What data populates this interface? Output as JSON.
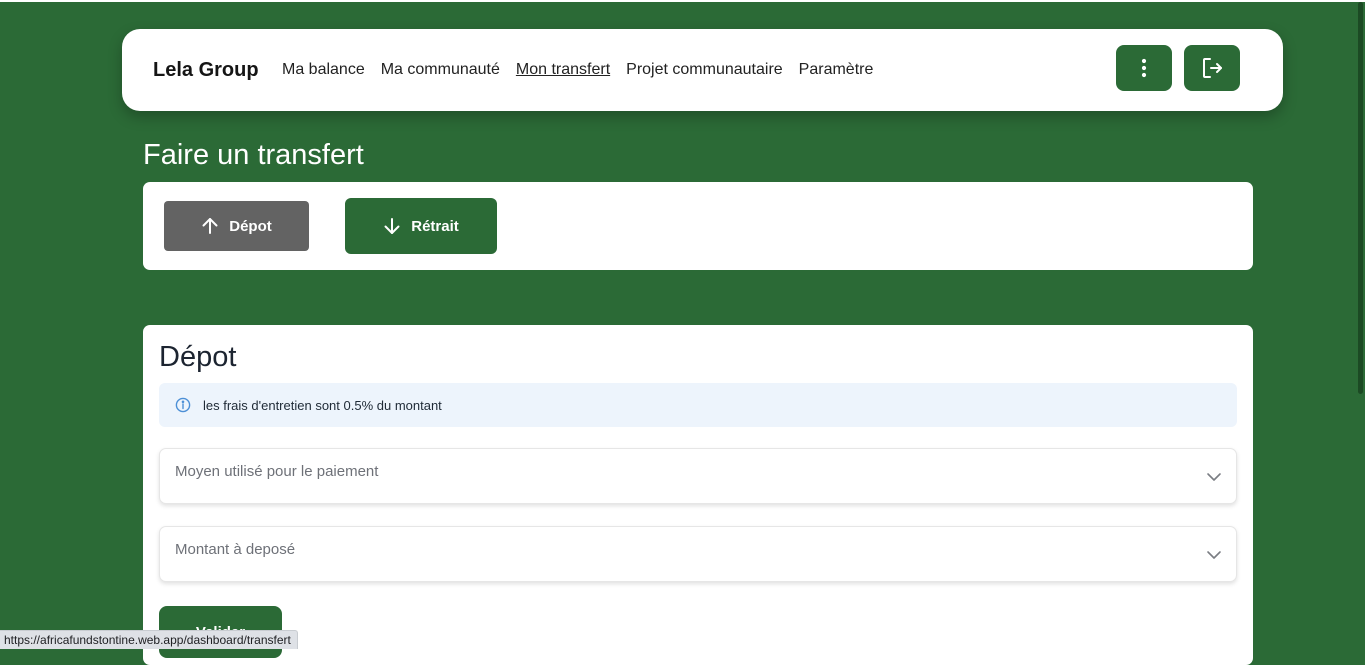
{
  "brand": "Lela Group",
  "nav": {
    "links": [
      "Ma balance",
      "Ma communauté",
      "Mon transfert",
      "Projet communautaire",
      "Paramètre"
    ],
    "active": "Mon transfert",
    "more_icon": "more-vertical-icon",
    "logout_icon": "logout-icon"
  },
  "page_title": "Faire un transfert",
  "toggle": {
    "depot_label": "Dépot",
    "retrait_label": "Rétrait"
  },
  "form": {
    "title": "Dépot",
    "info_text": "les frais d'entretien sont 0.5% du montant",
    "payment_method_label": "Moyen utilisé pour le paiement",
    "amount_label": "Montant à deposé",
    "submit_label": "Valider"
  },
  "status_url": "https://africafundstontine.web.app/dashboard/transfert",
  "colors": {
    "background": "#2b6a36",
    "primary_button": "#2b6a36",
    "inactive_button": "#636363",
    "info_bg": "#edf4fc",
    "info_icon": "#4c8fd6"
  }
}
